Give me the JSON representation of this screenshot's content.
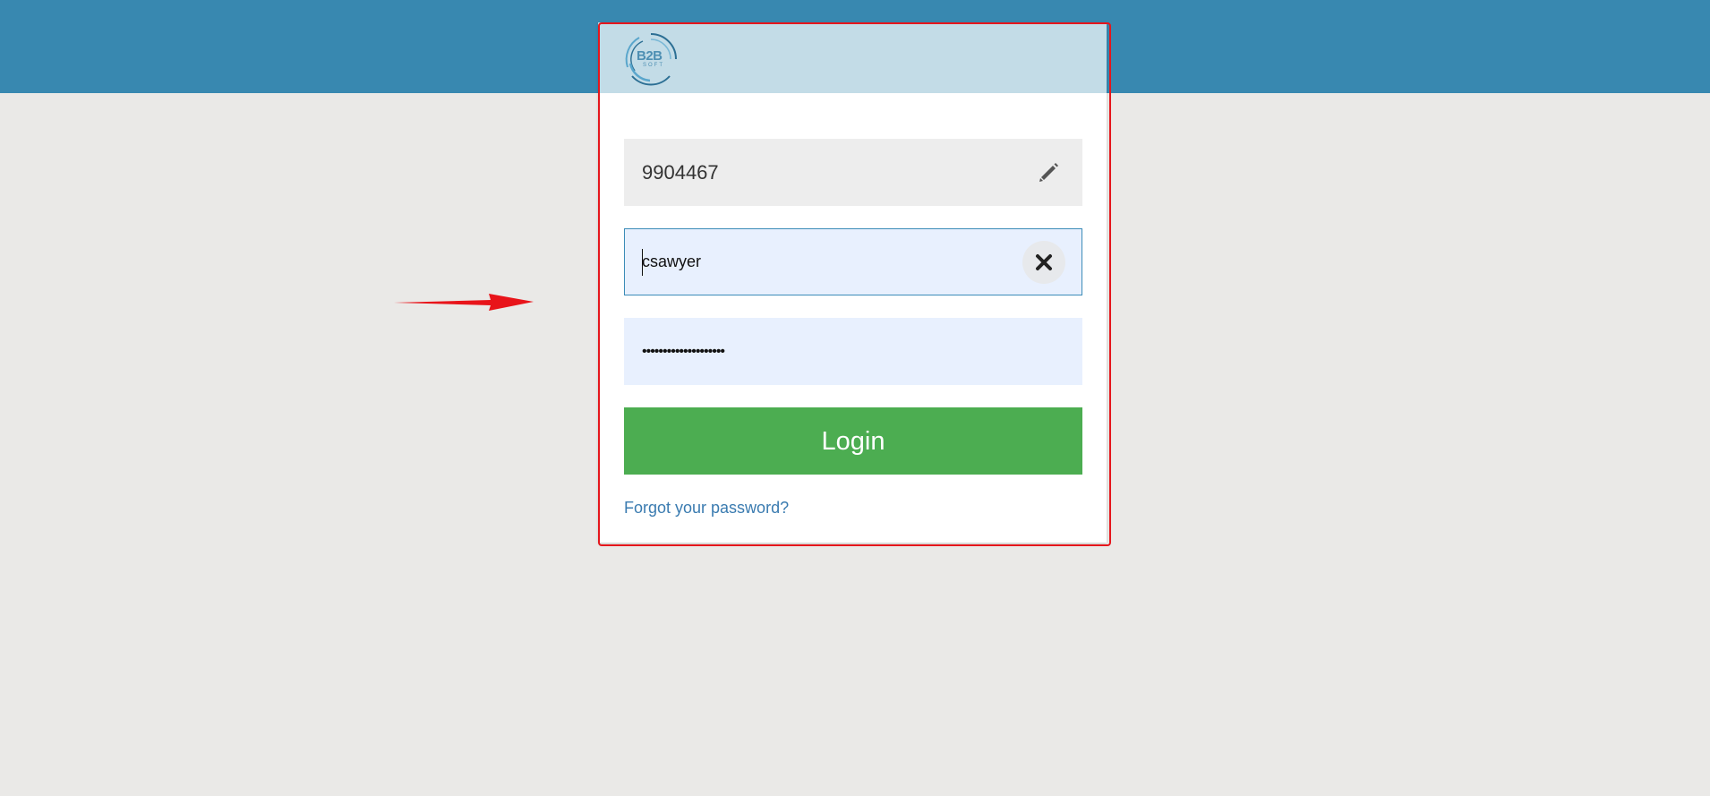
{
  "header": {
    "logo_text": "B2B",
    "logo_subtext": "SOFT"
  },
  "form": {
    "company_id_value": "9904467",
    "username_value": "csawyer",
    "password_value": "••••••••••••••••••••",
    "login_label": "Login",
    "forgot_password_label": "Forgot your password?"
  },
  "icons": {
    "company_field": "pencil-icon",
    "username_field": "close-icon"
  },
  "colors": {
    "topbar": "#3888b0",
    "login_button": "#4cad51",
    "link": "#3a7bb0",
    "annotation": "#e5161c"
  }
}
